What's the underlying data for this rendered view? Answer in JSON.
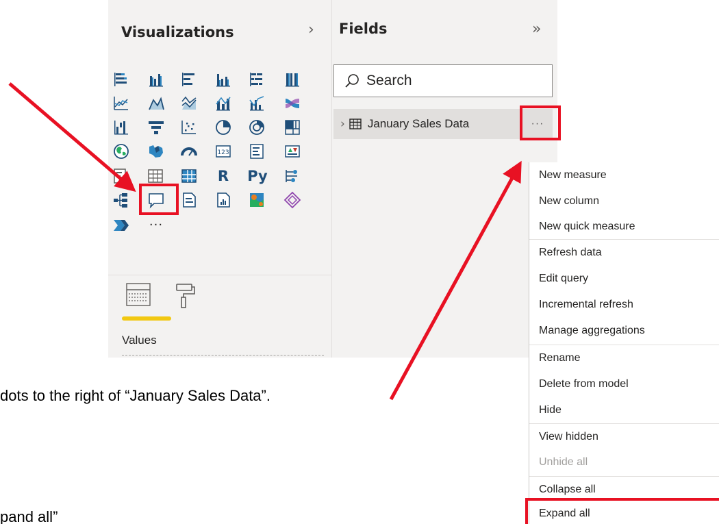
{
  "visualizations": {
    "title": "Visualizations",
    "values_label": "Values",
    "icons": [
      "stacked-bar-chart-icon",
      "stacked-column-chart-icon",
      "clustered-bar-chart-icon",
      "clustered-column-chart-icon",
      "100-percent-stacked-bar-chart-icon",
      "100-percent-stacked-column-chart-icon",
      "line-chart-icon",
      "area-chart-icon",
      "stacked-area-chart-icon",
      "line-and-stacked-column-chart-icon",
      "line-and-clustered-column-chart-icon",
      "ribbon-chart-icon",
      "waterfall-chart-icon",
      "funnel-icon",
      "scatter-chart-icon",
      "pie-chart-icon",
      "donut-chart-icon",
      "treemap-icon",
      "map-icon",
      "filled-map-icon",
      "gauge-icon",
      "card-icon",
      "multi-row-card-icon",
      "kpi-icon",
      "slicer-icon",
      "table-icon",
      "matrix-icon",
      "r-script-visual-icon",
      "python-visual-icon",
      "key-influencers-icon",
      "decomposition-tree-icon",
      "qa-icon",
      "smart-narrative-icon",
      "paginated-report-icon",
      "arcgis-map-icon",
      "power-apps-icon",
      "power-automate-icon",
      "more-visuals-icon"
    ],
    "r_label": "R",
    "py_label": "Py",
    "more_label": "···"
  },
  "fields": {
    "title": "Fields",
    "search_placeholder": "Search",
    "table_name": "January Sales Data",
    "more_label": "···"
  },
  "context_menu": {
    "items": [
      {
        "label": "New measure"
      },
      {
        "label": "New column"
      },
      {
        "label": "New quick measure"
      },
      {
        "label": "Refresh data"
      },
      {
        "label": "Edit query"
      },
      {
        "label": "Incremental refresh"
      },
      {
        "label": "Manage aggregations"
      },
      {
        "label": "Rename"
      },
      {
        "label": "Delete from model"
      },
      {
        "label": "Hide"
      },
      {
        "label": "View hidden"
      },
      {
        "label": "Unhide all",
        "disabled": true
      },
      {
        "label": "Collapse all"
      },
      {
        "label": "Expand all"
      }
    ]
  },
  "captions": {
    "dots_hint": "dots to the right of “January Sales Data”.",
    "expand_hint": "pand all”"
  },
  "colors": {
    "annotation_red": "#e81123",
    "pane_bg": "#f3f2f1",
    "active_tab_yellow": "#f2c811",
    "visual_blue": "#1f4e79"
  }
}
